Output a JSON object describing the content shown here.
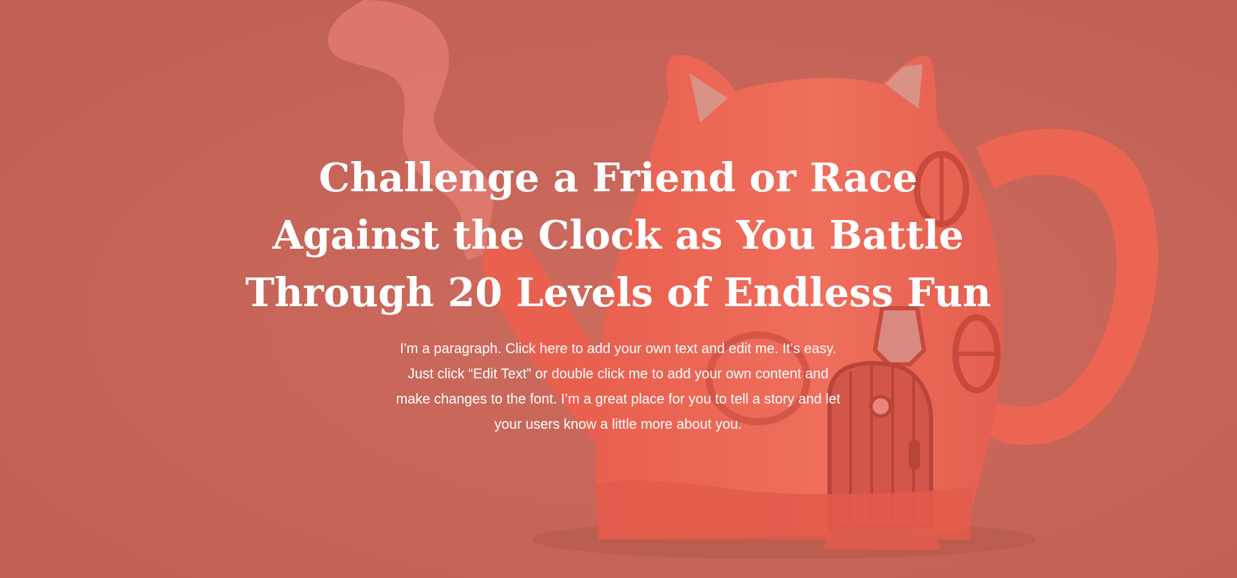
{
  "hero": {
    "headline_lines": [
      "Challenge a Friend or Race",
      "Against the Clock as You Battle",
      "Through 20 Levels of Endless Fun"
    ],
    "paragraph_lines": [
      "I'm a paragraph. Click here to add your own text and edit me. It’s easy.",
      "Just click “Edit Text” or double click me to add your own content and",
      "make changes to the font. I’m a great place for you to tell a story and let",
      "your users know a little more about you."
    ]
  },
  "colors": {
    "background": "#c5665a",
    "teapot": "#ea6a58",
    "teapot_shadow": "#d9584a",
    "steam": "#e0766d",
    "text": "#ffffff"
  },
  "icons": {
    "background_image": "cat-teapot-house-illustration"
  }
}
